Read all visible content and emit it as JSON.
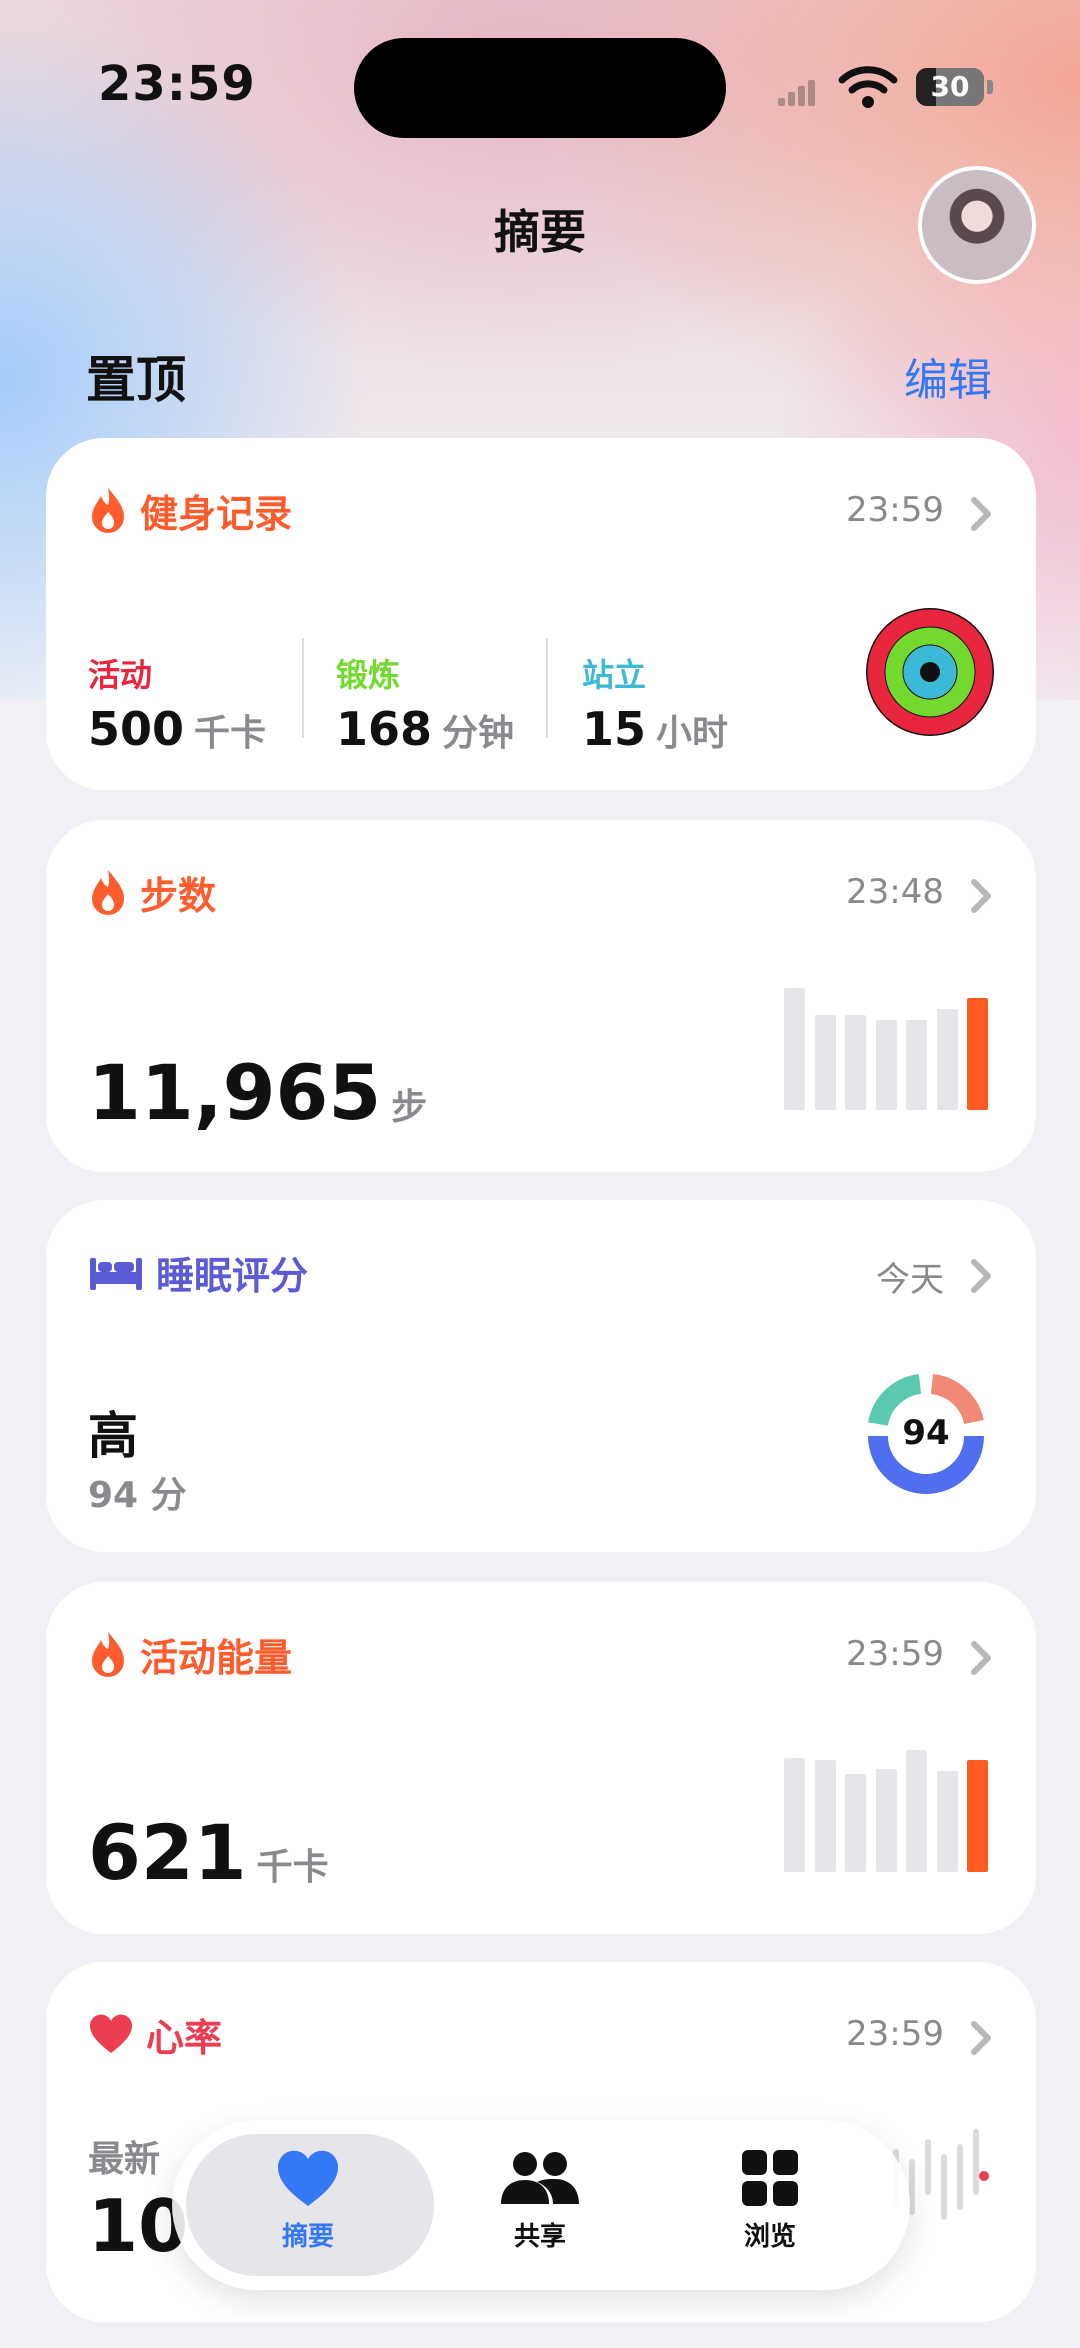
{
  "status_bar": {
    "time": "23:59",
    "battery": "30",
    "battery_level": 0.3
  },
  "nav": {
    "title": "摘要",
    "avatar_icon": "avatar"
  },
  "pinned": {
    "title": "置顶",
    "edit_label": "编辑"
  },
  "fitness_card": {
    "title": "健身记录",
    "time": "23:59",
    "icon": "flame-icon",
    "move": {
      "label": "活动",
      "value": "500",
      "unit": "千卡"
    },
    "exercise": {
      "label": "锻炼",
      "value": "168",
      "unit": "分钟"
    },
    "stand": {
      "label": "站立",
      "value": "15",
      "unit": "小时"
    }
  },
  "steps_card": {
    "title": "步数",
    "time": "23:48",
    "value": "11,965",
    "unit": "步",
    "icon": "flame-icon",
    "bar_values": [
      90,
      70,
      70,
      66,
      66,
      74
    ]
  },
  "sleep_card": {
    "title": "睡眠评分",
    "time": "今天",
    "rating": "高",
    "score_text": "94 分",
    "score": "94",
    "icon": "bed-icon"
  },
  "energy_card": {
    "title": "活动能量",
    "time": "23:59",
    "value": "621",
    "unit": "千卡",
    "icon": "flame-icon",
    "bar_values": [
      84,
      82,
      72,
      76,
      90,
      74,
      82
    ]
  },
  "heart_card": {
    "title": "心率",
    "time": "23:59",
    "latest_label": "最新",
    "value": "10",
    "icon": "heart-icon"
  },
  "tabs": [
    {
      "label": "摘要",
      "icon": "heart-icon",
      "selected": true
    },
    {
      "label": "共享",
      "icon": "people-icon",
      "selected": false
    },
    {
      "label": "浏览",
      "icon": "grid-icon",
      "selected": false
    }
  ],
  "colors": {
    "accent": "#3478f6",
    "fitness": "#ff5c2e",
    "move": "#e8263d",
    "exercise": "#73d92f",
    "stand": "#3cb9d6",
    "sleep": "#5b5bd6",
    "heart": "#ec3e50",
    "bar_highlight": "#ff5a22",
    "bar_muted": "#e6e6ea"
  }
}
